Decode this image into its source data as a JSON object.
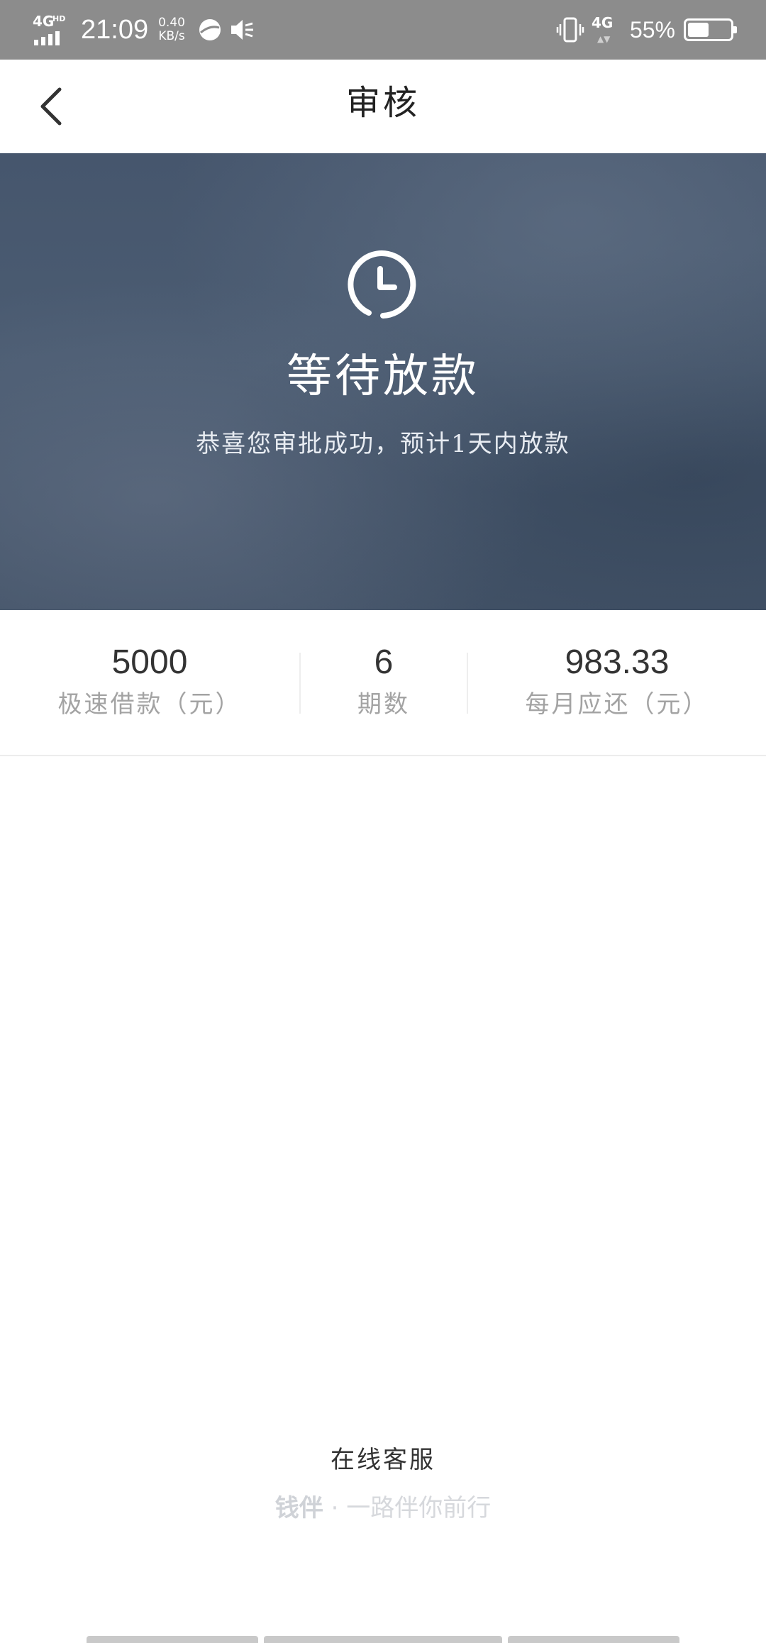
{
  "status_bar": {
    "network": "4G",
    "network_hd": "HD",
    "time": "21:09",
    "speed_value": "0.40",
    "speed_unit": "KB/s",
    "secondary_network": "4G",
    "battery_percent": "55%",
    "battery_level": 0.55
  },
  "header": {
    "title": "审核"
  },
  "banner": {
    "title": "等待放款",
    "subtitle": "恭喜您审批成功，预计1天内放款"
  },
  "stats": [
    {
      "value": "5000",
      "label": "极速借款（元）"
    },
    {
      "value": "6",
      "label": "期数"
    },
    {
      "value": "983.33",
      "label": "每月应还（元）"
    }
  ],
  "footer": {
    "service_label": "在线客服",
    "brand": "钱伴",
    "slogan": " · 一路伴你前行"
  },
  "colors": {
    "banner": "#4b5c72",
    "status_bar": "#8c8c8c"
  }
}
